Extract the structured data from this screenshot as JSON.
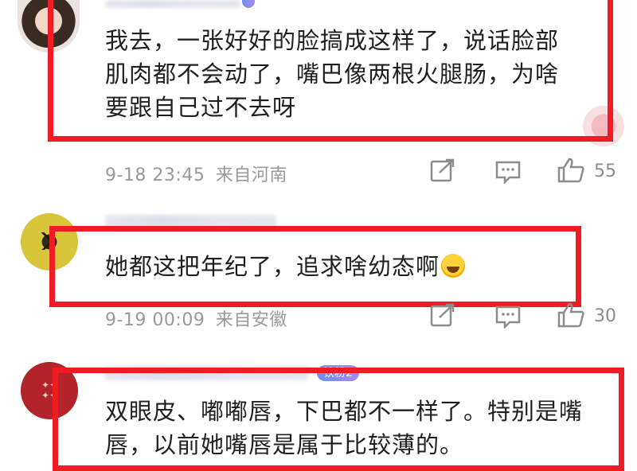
{
  "comments": [
    {
      "text_lines": [
        "我去，一张好好的脸搞成这样了，说话脸部",
        "肌肉都不会动了，嘴巴像两根火腿肠，为啥",
        "要跟自己过不去呀"
      ],
      "time": "9-18 23:45",
      "location": "来自河南",
      "likes": "55"
    },
    {
      "text": "她都这把年纪了，追求啥幼态啊",
      "emoji": "laughing-crying-emoji",
      "time": "9-19 00:09",
      "location": "来自安徽",
      "likes": "30"
    },
    {
      "badge": "铁粉2",
      "text_lines": [
        "双眼皮、嘟嘟唇，下巴都不一样了。特别是嘴",
        "唇，以前她嘴唇是属于比较薄的。"
      ]
    }
  ],
  "colors": {
    "highlight_box": "#ef1c24",
    "meta_text": "#9a9a9a",
    "badge": "#8a8ff0"
  },
  "icons": [
    "share-icon",
    "comment-icon",
    "like-icon"
  ]
}
